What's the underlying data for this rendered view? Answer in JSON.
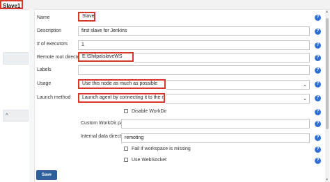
{
  "page": {
    "title": "Slave1"
  },
  "form": {
    "name": {
      "label": "Name",
      "value": "Slave1"
    },
    "description": {
      "label": "Description",
      "value": "first slave for Jenkins"
    },
    "executors": {
      "label": "# of executors",
      "value": "1"
    },
    "remote_root": {
      "label": "Remote root directory",
      "value": "E:\\Shilpa\\slaveWS"
    },
    "labels": {
      "label": "Labels",
      "value": ""
    },
    "usage": {
      "label": "Usage",
      "value": "Use this node as much as possible"
    },
    "launch_method": {
      "label": "Launch method",
      "value": "Launch agent by connecting it to the master"
    },
    "disable_workdir": {
      "label": "Disable WorkDir",
      "checked": false
    },
    "custom_workdir": {
      "label": "Custom WorkDir path",
      "value": ""
    },
    "internal_data_dir": {
      "label": "Internal data directory",
      "value": "remoting"
    },
    "fail_if_missing": {
      "label": "Fail if workspace is missing",
      "checked": false
    },
    "use_websocket": {
      "label": "Use WebSocket",
      "checked": false
    }
  },
  "actions": {
    "save_label": "Save"
  },
  "icons": {
    "help": "help-icon",
    "help_glyph": "?"
  },
  "colors": {
    "highlight": "#d9372a",
    "help": "#2f6fd6",
    "save_button": "#2d5f9a"
  }
}
